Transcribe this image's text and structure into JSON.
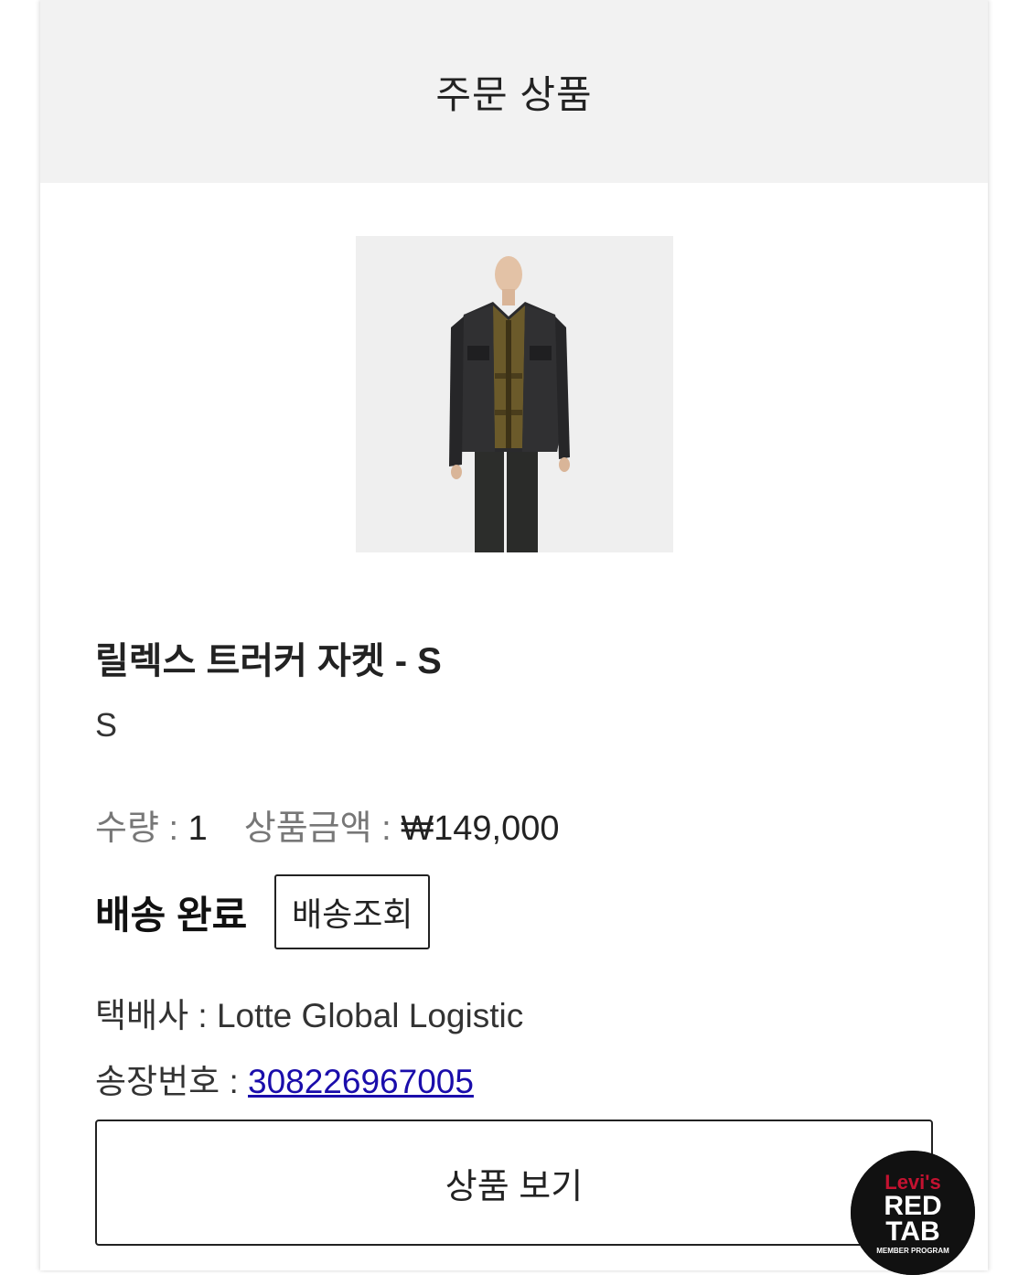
{
  "header": {
    "title": "주문 상품"
  },
  "product": {
    "image_alt": "product-photo",
    "name": "릴렉스 트러커 자켓 - S",
    "option": "S",
    "qty_label": "수량 : ",
    "qty_value": "1",
    "price_label": "상품금액 : ",
    "price_value": "₩149,000"
  },
  "shipping": {
    "status": "배송 완료",
    "track_button": "배송조회",
    "courier_label": "택배사 : ",
    "courier_value": "Lotte Global Logistic",
    "invoice_label": "송장번호 : ",
    "invoice_number": "308226967005"
  },
  "actions": {
    "view_product": "상품 보기"
  },
  "badge": {
    "line1": "Levi's",
    "line2": "RED",
    "line3": "TAB",
    "line4": "MEMBER PROGRAM"
  },
  "colors": {
    "header_bg": "#f2f2f2",
    "link": "#1a0dab",
    "badge_red": "#c41230"
  }
}
